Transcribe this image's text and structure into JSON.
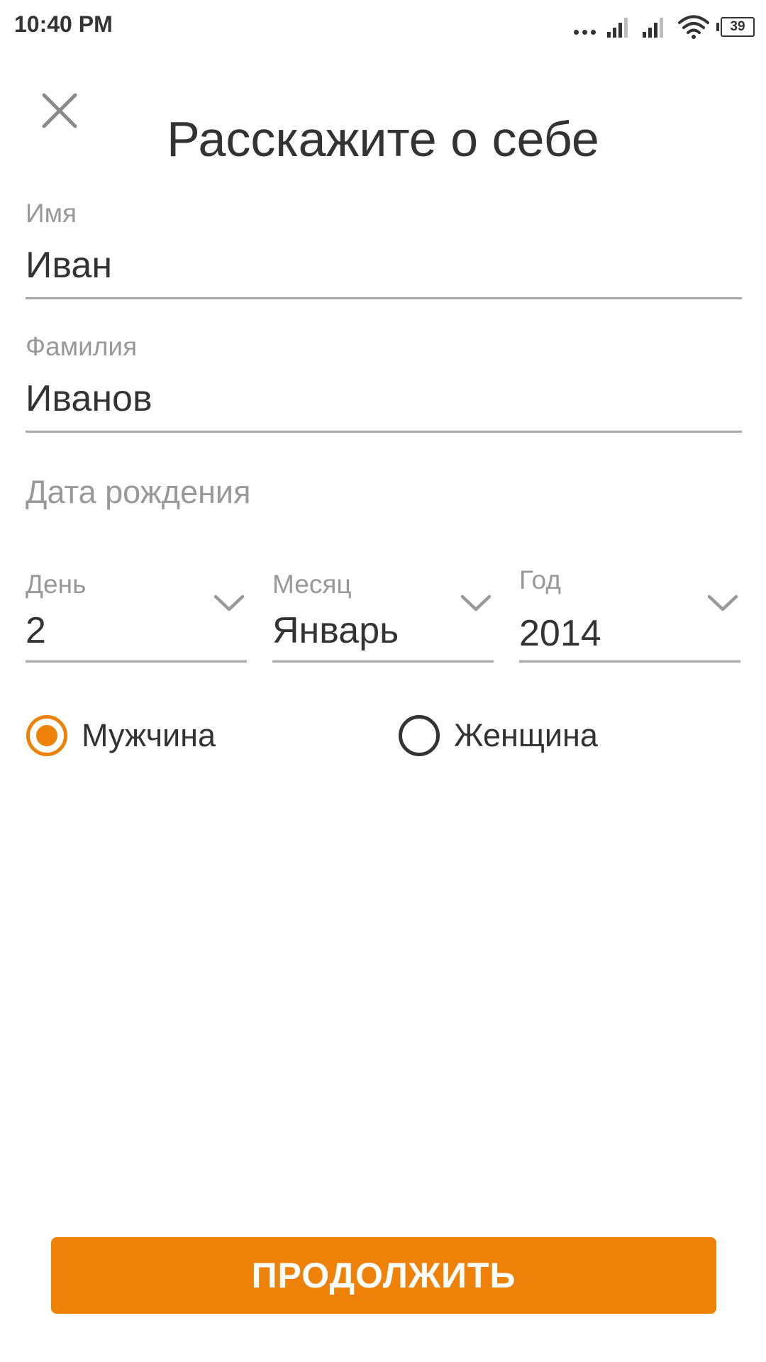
{
  "status_bar": {
    "time": "10:40 PM",
    "battery": "39"
  },
  "header": {
    "title": "Расскажите о себе",
    "close_icon": "close-icon"
  },
  "form": {
    "first_name": {
      "label": "Имя",
      "value": "Иван"
    },
    "last_name": {
      "label": "Фамилия",
      "value": "Иванов"
    },
    "birth_date_label": "Дата рождения",
    "day": {
      "label": "День",
      "value": "2"
    },
    "month": {
      "label": "Месяц",
      "value": "Январь"
    },
    "year": {
      "label": "Год",
      "value": "2014"
    },
    "gender": {
      "options": [
        {
          "label": "Мужчина",
          "selected": true
        },
        {
          "label": "Женщина",
          "selected": false
        }
      ]
    }
  },
  "continue_label": "ПРОДОЛЖИТЬ",
  "colors": {
    "accent": "#ee8208",
    "text": "#333333",
    "label": "#999999",
    "underline": "#a8a8a8"
  }
}
